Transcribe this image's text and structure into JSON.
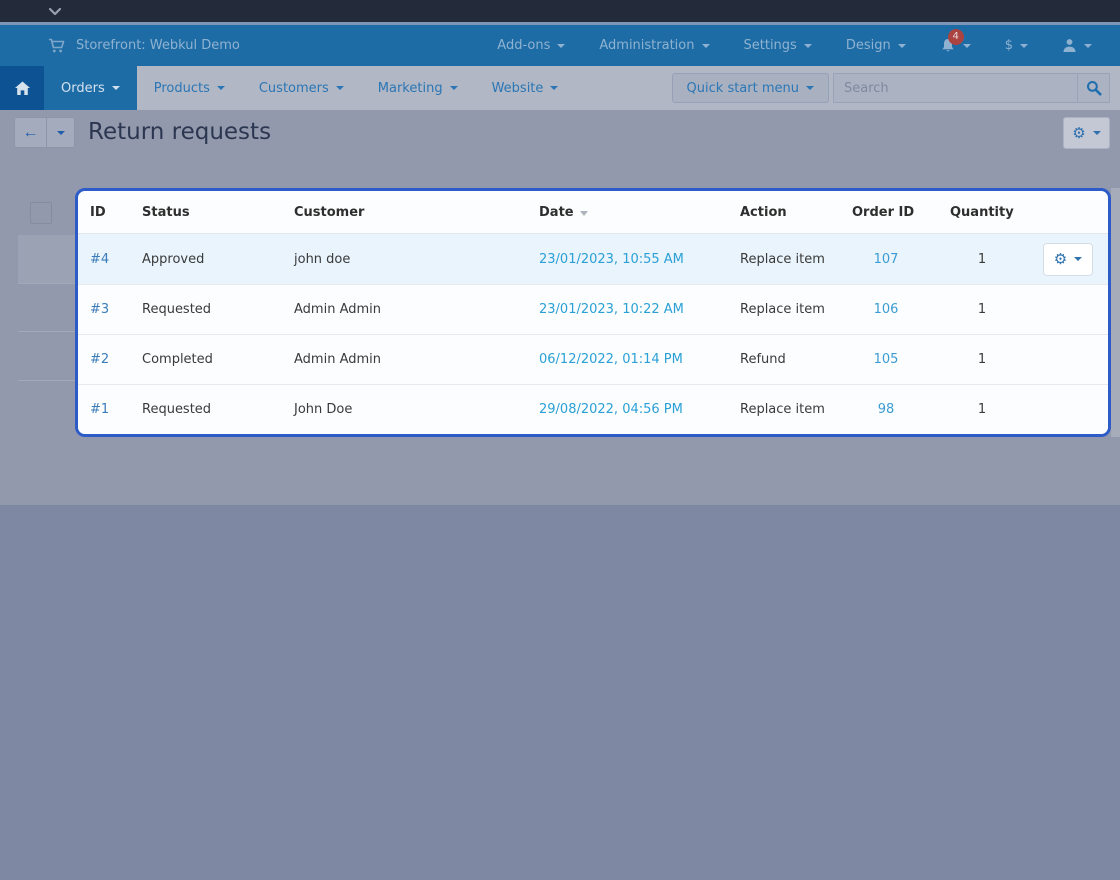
{
  "header": {
    "storefront_label": "Storefront: Webkul Demo",
    "menus": [
      "Add-ons",
      "Administration",
      "Settings",
      "Design"
    ],
    "notifications_count": "4",
    "currency_label": "$"
  },
  "nav": {
    "tabs": [
      {
        "label": "Orders",
        "active": true
      },
      {
        "label": "Products",
        "active": false
      },
      {
        "label": "Customers",
        "active": false
      },
      {
        "label": "Marketing",
        "active": false
      },
      {
        "label": "Website",
        "active": false
      }
    ],
    "quick_start_label": "Quick start menu",
    "search_placeholder": "Search"
  },
  "page": {
    "title": "Return requests"
  },
  "table": {
    "columns": [
      {
        "key": "id",
        "label": "ID",
        "sorted": false
      },
      {
        "key": "status",
        "label": "Status",
        "sorted": false
      },
      {
        "key": "customer",
        "label": "Customer",
        "sorted": false
      },
      {
        "key": "date",
        "label": "Date",
        "sorted": true
      },
      {
        "key": "action",
        "label": "Action",
        "sorted": false
      },
      {
        "key": "order_id",
        "label": "Order ID",
        "sorted": false
      },
      {
        "key": "quantity",
        "label": "Quantity",
        "sorted": false
      }
    ],
    "rows": [
      {
        "id": "#4",
        "status": "Approved",
        "customer": "john doe",
        "date": "23/01/2023, 10:55 AM",
        "action": "Replace item",
        "order_id": "107",
        "quantity": "1",
        "highlighted": true,
        "has_actions_button": true
      },
      {
        "id": "#3",
        "status": "Requested",
        "customer": "Admin Admin",
        "date": "23/01/2023, 10:22 AM",
        "action": "Replace item",
        "order_id": "106",
        "quantity": "1",
        "highlighted": false,
        "has_actions_button": false
      },
      {
        "id": "#2",
        "status": "Completed",
        "customer": "Admin Admin",
        "date": "06/12/2022, 01:14 PM",
        "action": "Refund",
        "order_id": "105",
        "quantity": "1",
        "highlighted": false,
        "has_actions_button": false
      },
      {
        "id": "#1",
        "status": "Requested",
        "customer": "John Doe",
        "date": "29/08/2022, 04:56 PM",
        "action": "Replace item",
        "order_id": "98",
        "quantity": "1",
        "highlighted": false,
        "has_actions_button": false
      }
    ]
  },
  "colors": {
    "header_blue": "#1e6ca6",
    "spotlight_border": "#2d5cc8",
    "link_blue": "#3b7cba",
    "link_cyan": "#2aa0d6",
    "badge_red": "#ab4341"
  }
}
